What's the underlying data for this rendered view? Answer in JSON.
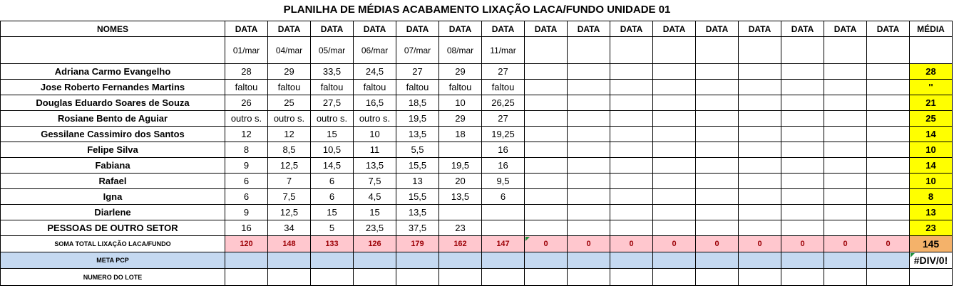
{
  "title": "PLANILHA DE MÉDIAS ACABAMENTO LIXAÇÃO LACA/FUNDO UNIDADE 01",
  "headers": {
    "nomes": "NOMES",
    "data": [
      "DATA",
      "DATA",
      "DATA",
      "DATA",
      "DATA",
      "DATA",
      "DATA",
      "DATA",
      "DATA",
      "DATA",
      "DATA",
      "DATA",
      "DATA",
      "DATA",
      "DATA",
      "DATA"
    ],
    "media": "MÉDIA"
  },
  "dates": [
    "01/mar",
    "04/mar",
    "05/mar",
    "06/mar",
    "07/mar",
    "08/mar",
    "11/mar",
    "",
    "",
    "",
    "",
    "",
    "",
    "",
    "",
    ""
  ],
  "rows": [
    {
      "name": "Adriana Carmo Evangelho",
      "values": [
        "28",
        "29",
        "33,5",
        "24,5",
        "27",
        "29",
        "27",
        "",
        "",
        "",
        "",
        "",
        "",
        "",
        "",
        ""
      ],
      "avg": "28"
    },
    {
      "name": "Jose Roberto Fernandes Martins",
      "values": [
        "faltou",
        "faltou",
        "faltou",
        "faltou",
        "faltou",
        "faltou",
        "faltou",
        "",
        "",
        "",
        "",
        "",
        "",
        "",
        "",
        ""
      ],
      "avg": "''"
    },
    {
      "name": "Douglas Eduardo Soares de Souza",
      "values": [
        "26",
        "25",
        "27,5",
        "16,5",
        "18,5",
        "10",
        "26,25",
        "",
        "",
        "",
        "",
        "",
        "",
        "",
        "",
        ""
      ],
      "avg": "21"
    },
    {
      "name": "Rosiane Bento de Aguiar",
      "values": [
        "outro s.",
        "outro s.",
        "outro s.",
        "outro s.",
        "19,5",
        "29",
        "27",
        "",
        "",
        "",
        "",
        "",
        "",
        "",
        "",
        ""
      ],
      "avg": "25"
    },
    {
      "name": "Gessilane Cassimiro dos Santos",
      "values": [
        "12",
        "12",
        "15",
        "10",
        "13,5",
        "18",
        "19,25",
        "",
        "",
        "",
        "",
        "",
        "",
        "",
        "",
        ""
      ],
      "avg": "14"
    },
    {
      "name": "Felipe Silva",
      "values": [
        "8",
        "8,5",
        "10,5",
        "11",
        "5,5",
        "",
        "16",
        "",
        "",
        "",
        "",
        "",
        "",
        "",
        "",
        ""
      ],
      "avg": "10"
    },
    {
      "name": "Fabiana",
      "values": [
        "9",
        "12,5",
        "14,5",
        "13,5",
        "15,5",
        "19,5",
        "16",
        "",
        "",
        "",
        "",
        "",
        "",
        "",
        "",
        ""
      ],
      "avg": "14"
    },
    {
      "name": "Rafael",
      "values": [
        "6",
        "7",
        "6",
        "7,5",
        "13",
        "20",
        "9,5",
        "",
        "",
        "",
        "",
        "",
        "",
        "",
        "",
        ""
      ],
      "avg": "10"
    },
    {
      "name": "Igna",
      "values": [
        "6",
        "7,5",
        "6",
        "4,5",
        "15,5",
        "13,5",
        "6",
        "",
        "",
        "",
        "",
        "",
        "",
        "",
        "",
        ""
      ],
      "avg": "8"
    },
    {
      "name": "Diarlene",
      "values": [
        "9",
        "12,5",
        "15",
        "15",
        "13,5",
        "",
        "",
        "",
        "",
        "",
        "",
        "",
        "",
        "",
        "",
        ""
      ],
      "avg": "13"
    },
    {
      "name": "PESSOAS DE OUTRO SETOR",
      "values": [
        "16",
        "34",
        "5",
        "23,5",
        "37,5",
        "23",
        "",
        "",
        "",
        "",
        "",
        "",
        "",
        "",
        "",
        ""
      ],
      "avg": "23"
    }
  ],
  "sum_row": {
    "label": "SOMA TOTAL LIXAÇÃO LACA/FUNDO",
    "values": [
      "120",
      "148",
      "133",
      "126",
      "179",
      "162",
      "147",
      "0",
      "0",
      "0",
      "0",
      "0",
      "0",
      "0",
      "0",
      "0"
    ],
    "avg": "145"
  },
  "meta_row": {
    "label": "META PCP",
    "avg": "#DIV/0!"
  },
  "lote_row": {
    "label": "NUMERO DO LOTE"
  },
  "colors": {
    "average_fill": "#ffff00",
    "sum_fill": "#ffc7ce",
    "sum_text": "#9c0006",
    "sum_avg_fill": "#f4b26a",
    "meta_fill": "#c5d9f1",
    "error_marker": "#1d8f3b"
  }
}
